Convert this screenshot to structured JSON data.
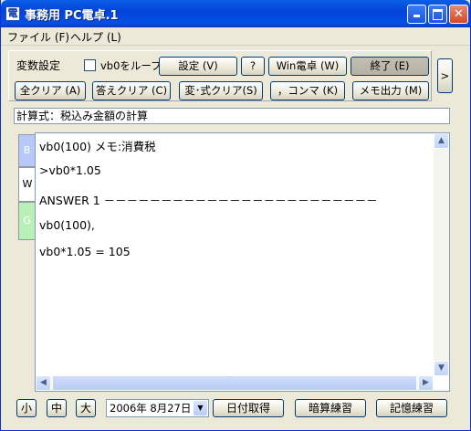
{
  "window": {
    "app_icon": "電",
    "title": "事務用 PC電卓.1",
    "minimize_icon": "minimize-icon",
    "maximize_icon": "maximize-icon",
    "close_icon": "close-icon"
  },
  "menu": {
    "file": "ファイル (F)",
    "help": "ヘルプ (L)"
  },
  "toolbar": {
    "vars_label": "変数設定",
    "loop_checkbox_label": "vb0をループ",
    "loop_checked": false,
    "settings": "設定 (V)",
    "help_q": "?",
    "win_calc": "Win電卓 (W)",
    "exit": "終了 (E)",
    "expand": ">",
    "clear_all": "全クリア (A)",
    "clear_answer": "答えクリア (C)",
    "clear_var": "変･式クリア(S)",
    "comma": "，コンマ (K)",
    "memo_out": "メモ出力 (M)"
  },
  "formula": {
    "value": "計算式：税込み金額の計算"
  },
  "side_tabs": [
    "B",
    "W",
    "G"
  ],
  "editor": {
    "lines": [
      "vb0(100)          メモ:消費税",
      ">vb0*1.05",
      "ANSWER 1 －－－－－－－－－－－－－－－－－－－－－－－－",
      " vb0(100),",
      " vb0*1.05 = 105"
    ]
  },
  "bottom": {
    "small": "小",
    "medium": "中",
    "large": "大",
    "date": "2006年  8月27日",
    "get_date": "日付取得",
    "mental_practice": "暗算練習",
    "memory_practice": "記憶練習"
  },
  "colors": {
    "titlebar": "#0a5ee6",
    "tab_b": "#b8c8f8",
    "tab_g": "#b8f0b8",
    "window_bg": "#ece9d8"
  }
}
